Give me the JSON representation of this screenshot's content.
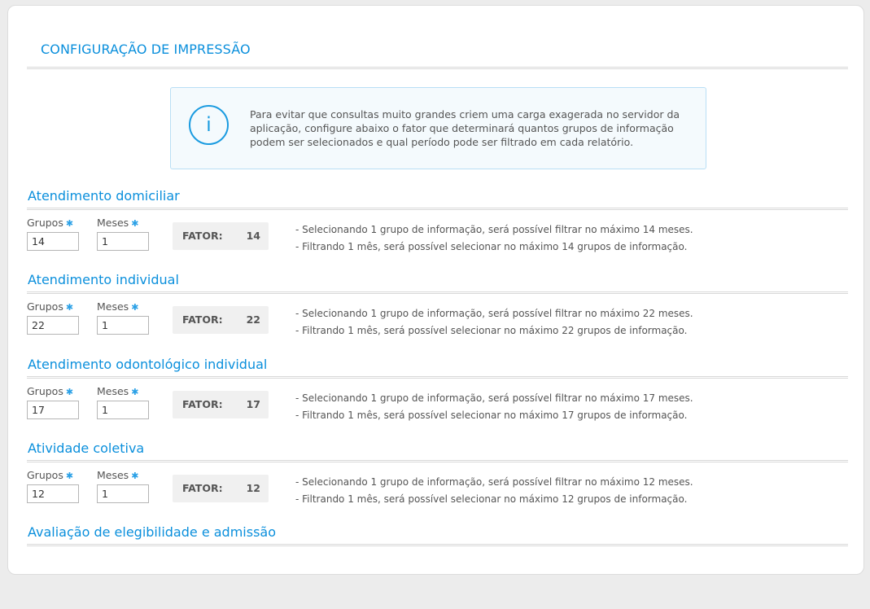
{
  "page": {
    "title": "CONFIGURAÇÃO DE IMPRESSÃO",
    "info_icon": "info-icon",
    "info_text": "Para evitar que consultas muito grandes criem uma carga exagerada no servidor da aplicação, configure abaixo o fator que determinará quantos grupos de informação podem ser selecionados e qual período pode ser filtrado em cada relatório."
  },
  "colors": {
    "accent": "#0a8fdc",
    "required_marker": "#2aa0e6",
    "info_border": "#b9dff5",
    "info_background": "#f4fafd"
  },
  "labels": {
    "grupos": "Grupos",
    "meses": "Meses",
    "required": "✱",
    "fator": "FATOR:"
  },
  "sections": [
    {
      "title": "Atendimento domiciliar",
      "grupos": "14",
      "meses": "1",
      "fator": "14",
      "desc1": "- Selecionando 1 grupo de informação, será possível filtrar no máximo 14 meses.",
      "desc2": "- Filtrando 1 mês, será possível selecionar no máximo 14 grupos de informação."
    },
    {
      "title": "Atendimento individual",
      "grupos": "22",
      "meses": "1",
      "fator": "22",
      "desc1": "- Selecionando 1 grupo de informação, será possível filtrar no máximo 22 meses.",
      "desc2": "- Filtrando 1 mês, será possível selecionar no máximo 22 grupos de informação."
    },
    {
      "title": "Atendimento odontológico individual",
      "grupos": "17",
      "meses": "1",
      "fator": "17",
      "desc1": "- Selecionando 1 grupo de informação, será possível filtrar no máximo 17 meses.",
      "desc2": "- Filtrando 1 mês, será possível selecionar no máximo 17 grupos de informação."
    },
    {
      "title": "Atividade coletiva",
      "grupos": "12",
      "meses": "1",
      "fator": "12",
      "desc1": "- Selecionando 1 grupo de informação, será possível filtrar no máximo 12 meses.",
      "desc2": "- Filtrando 1 mês, será possível selecionar no máximo 12 grupos de informação."
    },
    {
      "title": "Avaliação de elegibilidade e admissão"
    }
  ]
}
